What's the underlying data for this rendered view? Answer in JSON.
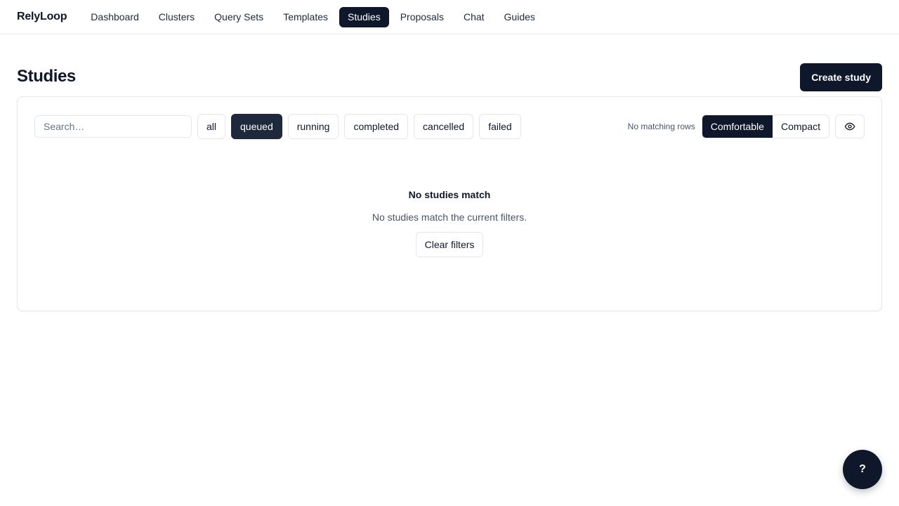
{
  "app": {
    "brand": "RelyLoop"
  },
  "nav": {
    "items": [
      {
        "label": "Dashboard",
        "active": false
      },
      {
        "label": "Clusters",
        "active": false
      },
      {
        "label": "Query Sets",
        "active": false
      },
      {
        "label": "Templates",
        "active": false
      },
      {
        "label": "Studies",
        "active": true
      },
      {
        "label": "Proposals",
        "active": false
      },
      {
        "label": "Chat",
        "active": false
      },
      {
        "label": "Guides",
        "active": false
      }
    ]
  },
  "header": {
    "title": "Studies",
    "create_label": "Create study"
  },
  "filters": {
    "search_placeholder": "Search…",
    "search_value": "",
    "chips": [
      {
        "label": "all",
        "active": false
      },
      {
        "label": "queued",
        "active": true
      },
      {
        "label": "running",
        "active": false
      },
      {
        "label": "completed",
        "active": false
      },
      {
        "label": "cancelled",
        "active": false
      },
      {
        "label": "failed",
        "active": false
      }
    ]
  },
  "view": {
    "status": "No matching rows",
    "density": {
      "comfortable": "Comfortable",
      "compact": "Compact",
      "selected": "Comfortable"
    },
    "columns_icon": "eye-icon"
  },
  "empty_state": {
    "title": "No studies match",
    "description": "No studies match the current filters.",
    "clear_label": "Clear filters"
  },
  "help": {
    "label": "?"
  },
  "colors": {
    "primary": "#0f172a",
    "chip_active": "#1e293b",
    "border": "#e5e7eb",
    "muted_text": "#475569"
  }
}
